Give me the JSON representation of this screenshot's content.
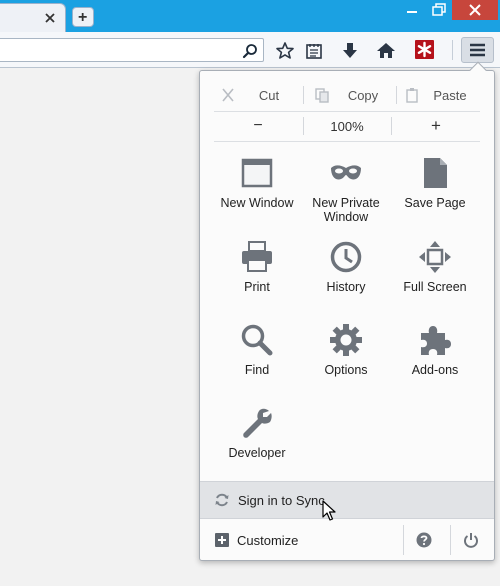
{
  "colors": {
    "titlebar": "#1ba1e2",
    "close_red": "#c7463c",
    "icon_gray": "#6d737b",
    "lastpass_red": "#b5121b"
  },
  "tabs": {
    "new_tab_symbol": "+"
  },
  "menu": {
    "edit": {
      "cut_label": "Cut",
      "copy_label": "Copy",
      "paste_label": "Paste"
    },
    "zoom": {
      "out_symbol": "−",
      "level": "100%",
      "in_symbol": "+"
    },
    "items": [
      {
        "label": "New Window",
        "icon": "new-window-icon"
      },
      {
        "label": "New Private\nWindow",
        "icon": "private-mask-icon"
      },
      {
        "label": "Save Page",
        "icon": "save-page-icon"
      },
      {
        "label": "Print",
        "icon": "printer-icon"
      },
      {
        "label": "History",
        "icon": "clock-icon"
      },
      {
        "label": "Full Screen",
        "icon": "fullscreen-icon"
      },
      {
        "label": "Find",
        "icon": "magnifier-icon"
      },
      {
        "label": "Options",
        "icon": "gear-icon"
      },
      {
        "label": "Add-ons",
        "icon": "puzzle-icon"
      },
      {
        "label": "Developer",
        "icon": "wrench-icon"
      }
    ],
    "sync_label": "Sign in to Sync",
    "customize_label": "Customize"
  }
}
